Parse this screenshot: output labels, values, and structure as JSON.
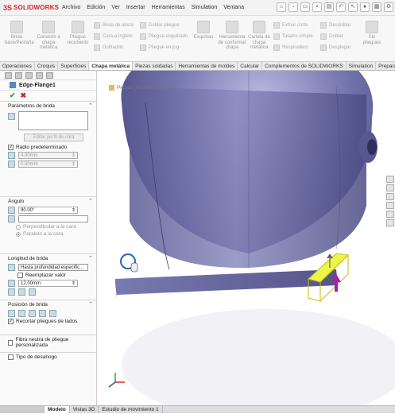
{
  "app": {
    "logo_prefix": "3S",
    "logo_text": "SOLIDWORKS"
  },
  "menu": [
    "Archivo",
    "Edición",
    "Ver",
    "Insertar",
    "Herramientas",
    "Simulation",
    "Ventana"
  ],
  "ribbon": {
    "buttons": [
      {
        "label": "Brida base/Pestaña"
      },
      {
        "label": "Convertir a chapa metálica"
      },
      {
        "label": "Pliegue recubierto"
      }
    ],
    "col1": [
      "Brida de arista",
      "Cara-a inglete",
      "Dobladillo"
    ],
    "col2": [
      "Doblar pliegue",
      "Pliegue esquinado",
      "Pliegue en jog"
    ],
    "buttons2": [
      {
        "label": "Esquinas"
      },
      {
        "label": "Herramienta de conformar chapa"
      },
      {
        "label": "Cartela de chapa metálica"
      }
    ],
    "col3": [
      "Extruir corte",
      "Taladro simple",
      "Respiradero"
    ],
    "col4": [
      "Desdoblar",
      "Doblar",
      "Desplegar"
    ],
    "button3": {
      "label": "Sin pliegues"
    }
  },
  "command_tabs": [
    "Operaciones",
    "Croquis",
    "Superficies",
    "Chapa metálica",
    "Piezas soldadas",
    "Herramientas de moldes",
    "Calcular",
    "Complementos de SOLIDWORKS",
    "Simulation",
    "Preparació..."
  ],
  "active_tab": "Chapa metálica",
  "property_manager": {
    "title": "Edge-Flange1",
    "sections": {
      "params": {
        "header": "Parámetros de brida",
        "edit_button": "Editar perfil de cara",
        "default_radius_label": "Radio predeterminado",
        "radius": "4.00mm",
        "thickness": "0.50mm"
      },
      "angle": {
        "header": "Ángulo",
        "value": "90.00°",
        "opt_perpendicular": "Perpendicular a la cara",
        "opt_parallel": "Paralelo a la cara"
      },
      "length": {
        "header": "Longitud de brida",
        "mode": "Hasta profundidad especific...",
        "replace_label": "Reemplazar valor",
        "value": "12.00mm"
      },
      "position": {
        "header": "Posición de brida",
        "trim_label": "Recortar pliegues de lados"
      },
      "fiber_label": "Fibra neutra de pliegue personalizada",
      "relief_label": "Tipo de desahogo"
    }
  },
  "viewport": {
    "breadcrumb": "Pieza2  (Predeterminado<..."
  },
  "bottom_tabs": [
    "Modelo",
    "Vistas 3D",
    "Estudio de movimiento 1"
  ],
  "active_bottom_tab": "Modelo",
  "colors": {
    "brand": "#d22222",
    "accent": "#5a86c5",
    "body": "#6c6ca8",
    "flange": "#e6f23a"
  }
}
